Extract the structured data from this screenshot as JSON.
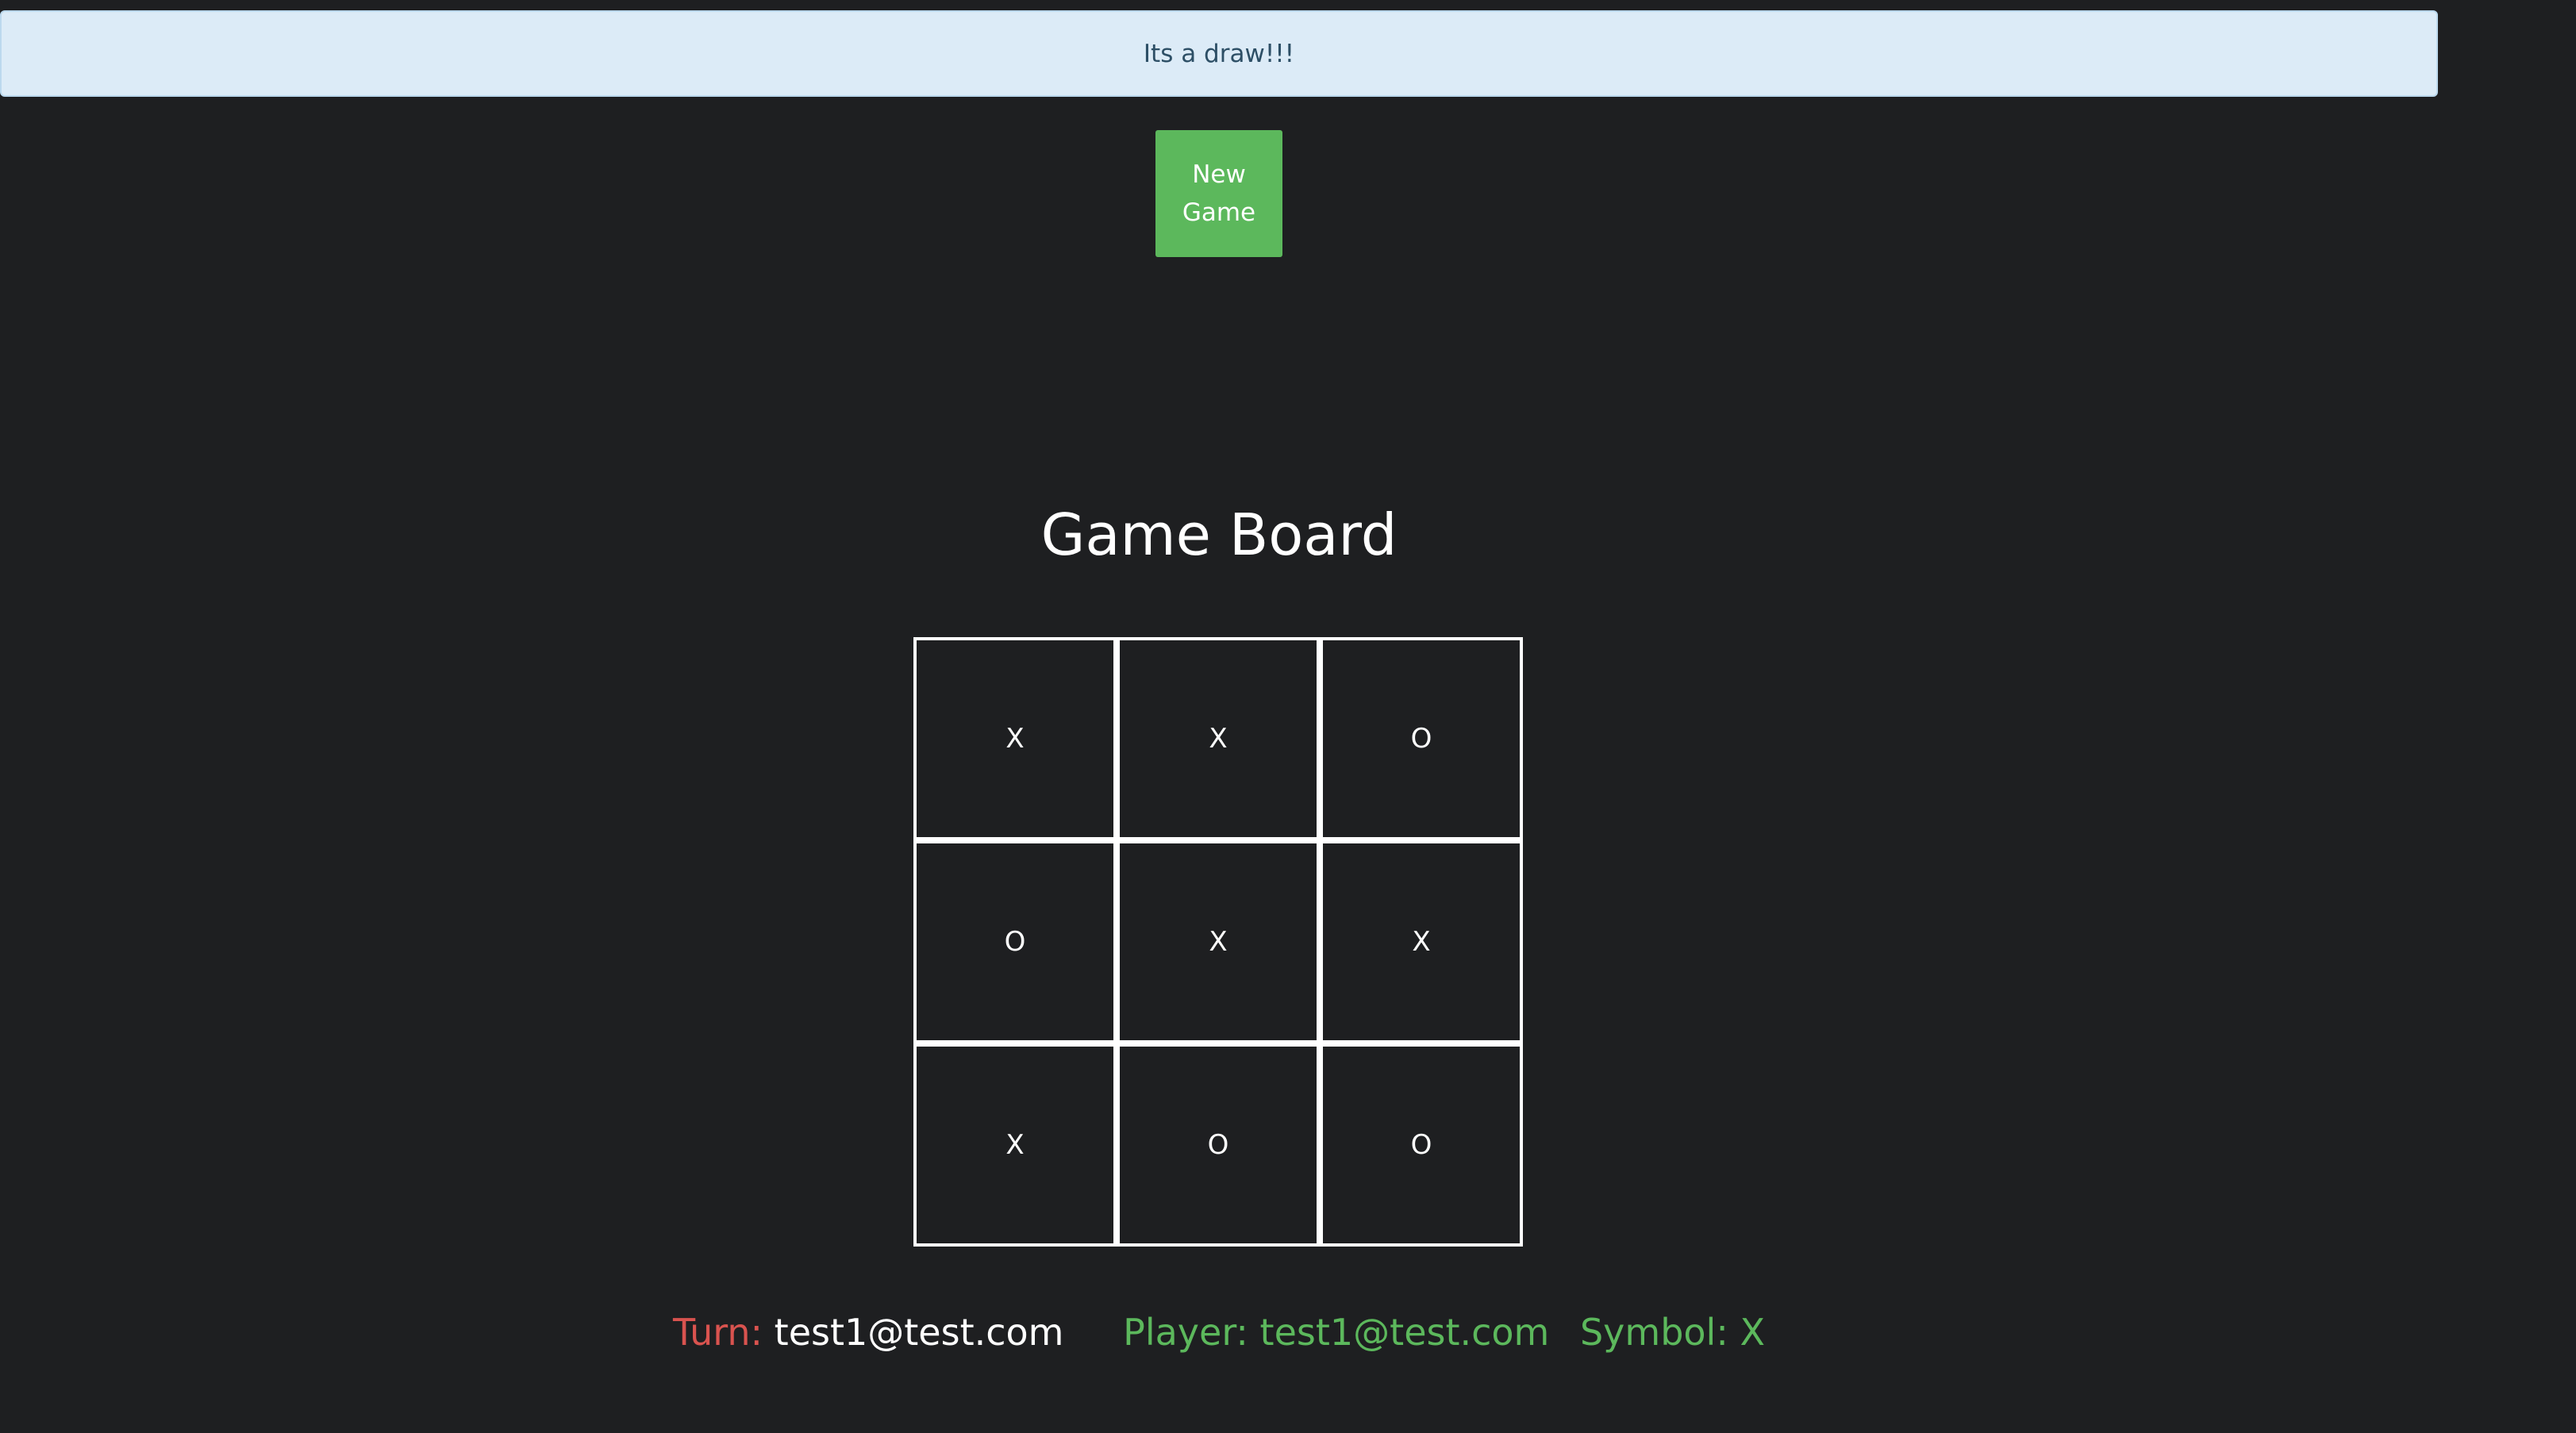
{
  "alert": {
    "message": "Its a draw!!!"
  },
  "controls": {
    "new_game_label": "New Game"
  },
  "board": {
    "title": "Game Board",
    "cells": [
      "X",
      "X",
      "O",
      "O",
      "X",
      "X",
      "X",
      "O",
      "O"
    ]
  },
  "status": {
    "turn_label": "Turn:",
    "turn_value": "test1@test.com",
    "player_text": "Player: test1@test.com",
    "symbol_text": "Symbol: X"
  },
  "colors": {
    "background": "#1e1f21",
    "alert_bg": "#dcebf7",
    "button_green": "#5cb85c",
    "turn_red": "#d9534f"
  }
}
